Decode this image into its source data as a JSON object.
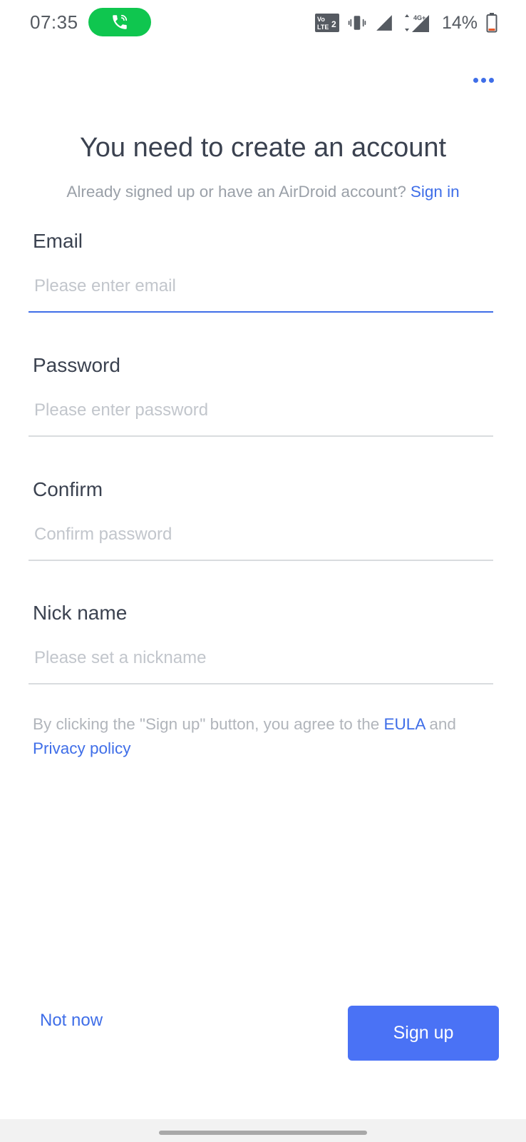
{
  "status_bar": {
    "time": "07:35",
    "battery": "14%",
    "icons": [
      "phone-call-icon",
      "volte-icon",
      "vibrate-icon",
      "signal-icon",
      "data-4g-icon",
      "battery-icon"
    ],
    "call_pill_color": "#0fc64f"
  },
  "header": {
    "more_icon": "more-horizontal-icon"
  },
  "page": {
    "title": "You need to create an account",
    "subtitle": "Already signed up or have an AirDroid account?",
    "sign_in_link": "Sign in"
  },
  "form": {
    "email": {
      "label": "Email",
      "placeholder": "Please enter email",
      "value": ""
    },
    "password": {
      "label": "Password",
      "placeholder": "Please enter password",
      "value": ""
    },
    "confirm": {
      "label": "Confirm",
      "placeholder": "Confirm password",
      "value": ""
    },
    "nickname": {
      "label": "Nick name",
      "placeholder": "Please set a nickname",
      "value": ""
    }
  },
  "agreement": {
    "prefix": "By clicking the \"Sign up\" button, you agree to the",
    "eula_link": "EULA",
    "conjunction": "and",
    "privacy_link": "Privacy policy"
  },
  "actions": {
    "not_now": "Not now",
    "sign_up": "Sign up"
  },
  "colors": {
    "accent": "#3f6ee8",
    "button": "#4a72f5",
    "text": "#3b4250",
    "muted": "#9aa0a8",
    "placeholder": "#c2c6cc"
  }
}
